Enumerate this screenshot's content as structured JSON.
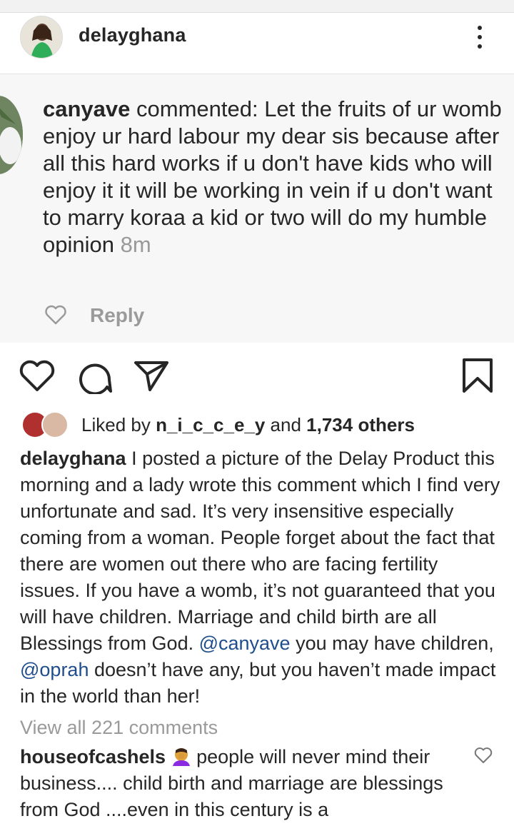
{
  "post": {
    "username": "delayghana",
    "more_icon": "more-vertical-icon"
  },
  "embedded_comment": {
    "username": "canyave",
    "text": " commented: Let the fruits of ur womb enjoy ur hard labour my dear sis because after all this hard works if u don't have kids who will enjoy it it will be working in vein if u don't want to marry koraa a kid or two will do my humble opinion ",
    "time": "8m",
    "reply_label": "Reply"
  },
  "actions": {
    "like_icon": "heart-icon",
    "comment_icon": "comment-icon",
    "share_icon": "send-icon",
    "save_icon": "bookmark-icon"
  },
  "likes": {
    "prefix": "Liked by ",
    "user": "n_i_c_c_e_y",
    "middle": " and ",
    "others": "1,734 others"
  },
  "caption": {
    "username": "delayghana",
    "text_part1": " I posted a picture of the Delay Product this morning and a lady wrote this comment which I find very unfortunate and sad. It’s very insensitive especially coming from a woman. People forget about the fact that there are women out there who are facing fertility issues. If you have a womb, it’s not guaranteed that you will have children. Marriage and child birth are all Blessings from God. ",
    "mention1": "@canyave",
    "text_part2": " you may have children, ",
    "mention2": "@oprah",
    "text_part3": " doesn’t have any, but you haven’t made impact in the world than her!"
  },
  "view_all_comments": "View all 221 comments",
  "comment": {
    "username": "houseofcashels",
    "emoji": "facepalm-emoji",
    "text": " people will never mind their business.... child birth  and marriage are blessings from God ....even in this century is a"
  },
  "colors": {
    "text": "#262626",
    "muted": "#9a9a9a",
    "mention": "#1f4e8c",
    "embed_bg": "#f7f7f7"
  }
}
